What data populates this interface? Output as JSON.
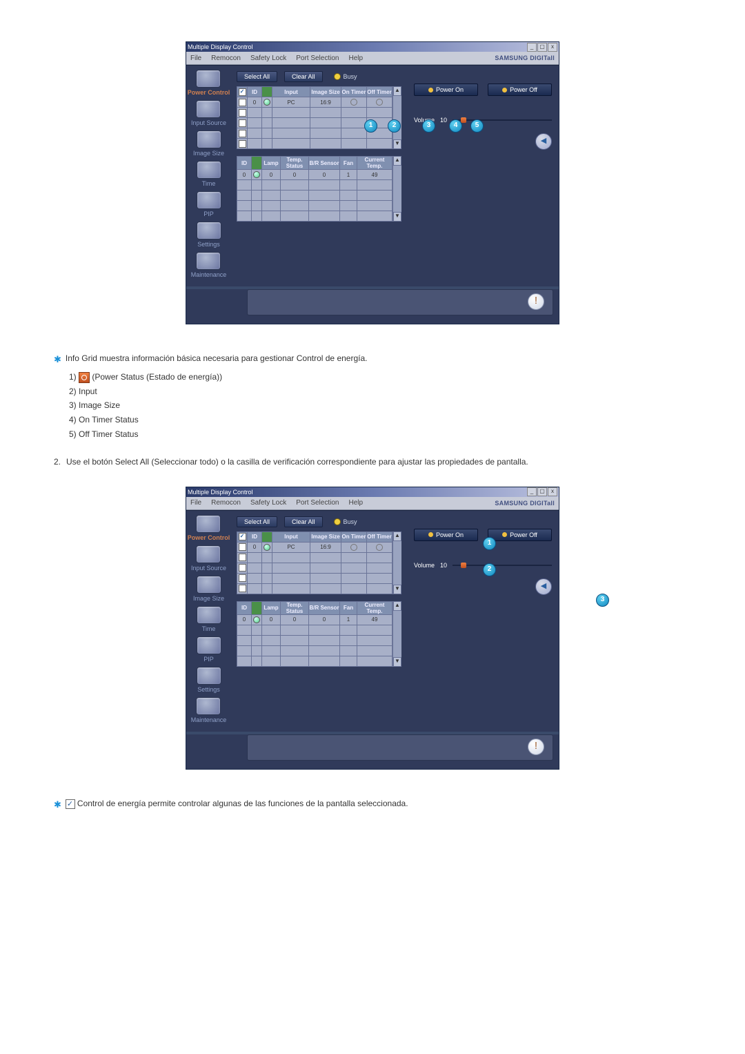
{
  "window": {
    "title": "Multiple Display Control",
    "menu": [
      "File",
      "Remocon",
      "Safety Lock",
      "Port Selection",
      "Help"
    ],
    "brand": "SAMSUNG DIGITall"
  },
  "sidebar": {
    "items": [
      {
        "label": "Power Control",
        "active": true
      },
      {
        "label": "Input Source"
      },
      {
        "label": "Image Size"
      },
      {
        "label": "Time"
      },
      {
        "label": "PIP"
      },
      {
        "label": "Settings"
      },
      {
        "label": "Maintenance"
      }
    ]
  },
  "toolbar": {
    "select_all": "Select All",
    "clear_all": "Clear All",
    "busy": "Busy"
  },
  "grid1": {
    "headers": [
      "",
      "ID",
      "",
      "Input",
      "Image Size",
      "On Timer",
      "Off Timer"
    ],
    "row": {
      "id": "0",
      "input": "PC",
      "image_size": "16:9",
      "on": "○",
      "off": "○"
    }
  },
  "grid2": {
    "headers": [
      "ID",
      "",
      "Lamp",
      "Temp. Status",
      "B/R Sensor",
      "Fan",
      "Current Temp."
    ],
    "row": {
      "id": "0",
      "lamp": "0",
      "temp": "0",
      "br": "0",
      "fan": "1",
      "cur": "49"
    }
  },
  "right_panel": {
    "power_on": "Power On",
    "power_off": "Power Off",
    "volume_label": "Volume",
    "volume_value": "10"
  },
  "markers": {
    "m1": "1",
    "m2": "2",
    "m3": "3",
    "m4": "4",
    "m5": "5"
  },
  "text": {
    "intro": "Info Grid muestra información básica necesaria para gestionar Control de energía.",
    "items": {
      "i1_pre": "1) ",
      "i1_post": " (Power Status (Estado de energía))",
      "i2": "2) Input",
      "i3": "3) Image Size",
      "i4": "4) On Timer Status",
      "i5": "5) Off Timer Status"
    },
    "para2_num": "2.",
    "para2": "Use el botón Select All (Seleccionar todo) o la casilla de verificación correspondiente para ajustar las propiedades de pantalla.",
    "outro": "Control de energía permite controlar algunas de las funciones de la pantalla seleccionada."
  }
}
